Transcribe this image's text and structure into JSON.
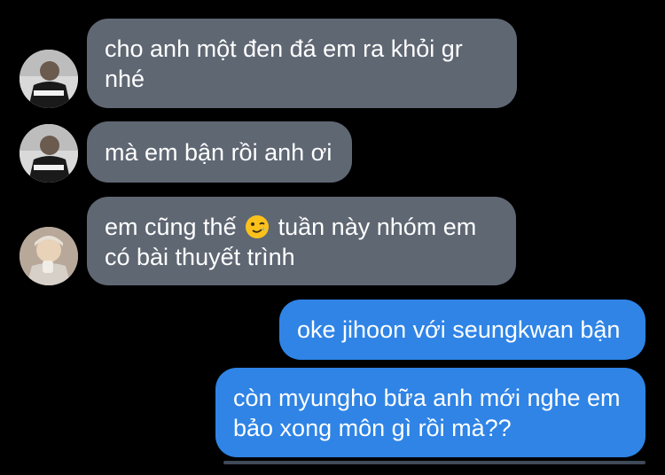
{
  "chat": {
    "messages": [
      {
        "sender": "incoming",
        "avatar": "avatar-1",
        "lines": [
          "cho anh một đen đá em ra khỏi gr",
          "nhé"
        ]
      },
      {
        "sender": "incoming",
        "avatar": "avatar-1",
        "lines": [
          "mà em bận rồi anh ơi"
        ]
      },
      {
        "sender": "incoming",
        "avatar": "avatar-2",
        "line1_before_emoji": "em cũng thế",
        "emoji": "smiling-face-with-tear-icon",
        "line1_after_emoji": "tuần này nhóm em",
        "lines": [
          "có bài thuyết trình"
        ]
      },
      {
        "sender": "outgoing",
        "lines": [
          "oke jihoon với seungkwan bận"
        ]
      },
      {
        "sender": "outgoing",
        "lines": [
          "còn myungho bữa anh mới nghe em",
          "bảo xong môn gì rồi mà??"
        ]
      }
    ]
  },
  "colors": {
    "background": "#000000",
    "incoming_bubble": "#5f6773",
    "outgoing_bubble": "#2f84e6",
    "text": "#ffffff"
  }
}
